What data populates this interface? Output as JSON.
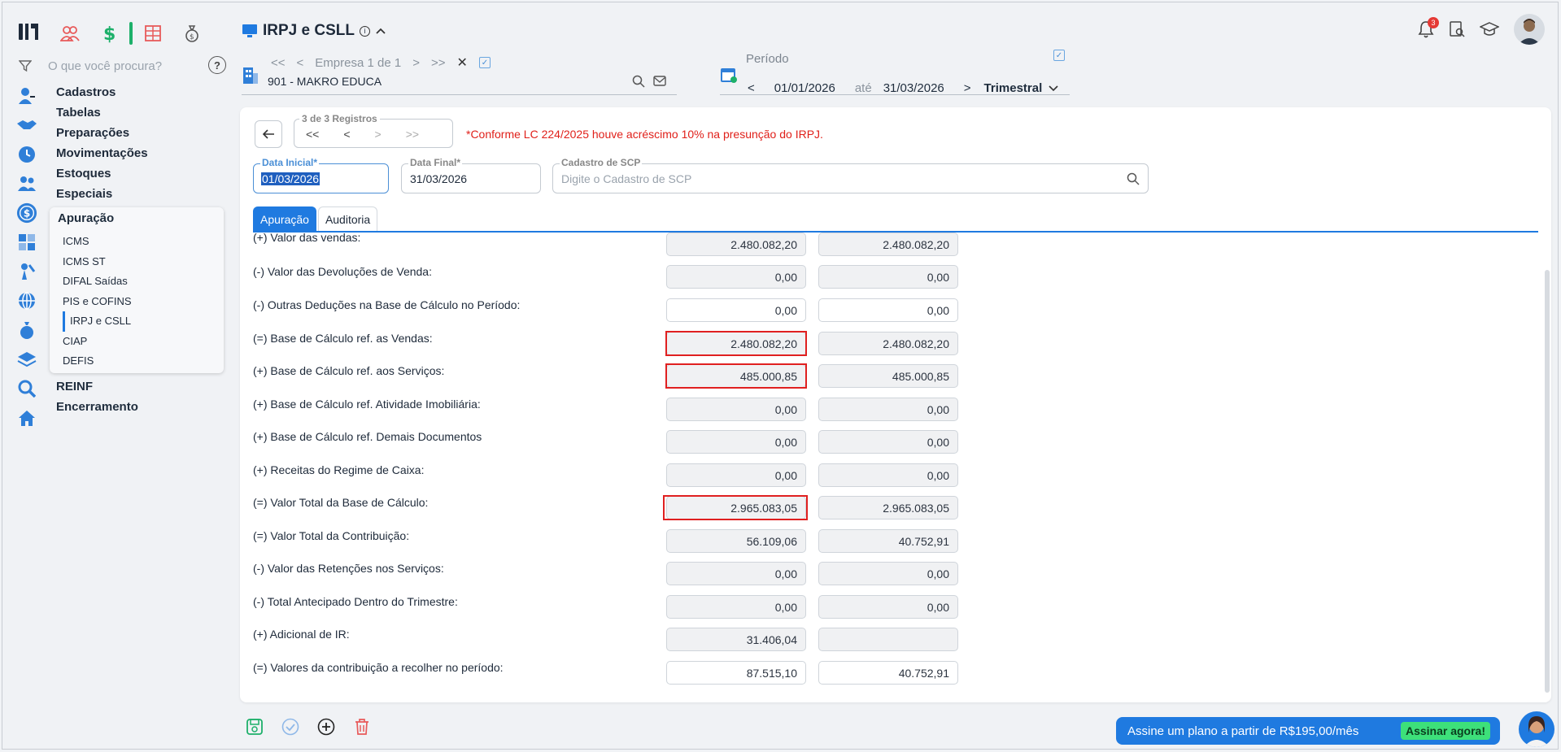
{
  "header": {
    "title": "IRPJ e CSLL",
    "search_placeholder": "O que você procura?",
    "notification_count": "3"
  },
  "menu": {
    "top_items": [
      "Cadastros",
      "Tabelas",
      "Preparações",
      "Movimentações",
      "Estoques",
      "Especiais"
    ],
    "section": "Apuração",
    "sub_items": [
      "ICMS",
      "ICMS ST",
      "DIFAL Saídas",
      "PIS e COFINS",
      "IRPJ e CSLL",
      "CIAP",
      "DEFIS"
    ],
    "active_sub": "IRPJ e CSLL",
    "bottom_items": [
      "REINF",
      "Encerramento"
    ]
  },
  "company": {
    "nav_label": "Empresa 1 de 1",
    "name": "901 - MAKRO EDUCA"
  },
  "periodo": {
    "label": "Período",
    "start": "01/01/2026",
    "sep": "até",
    "end": "31/03/2026",
    "type": "Trimestral"
  },
  "records": {
    "label": "3 de 3 Registros",
    "warning": "*Conforme LC 224/2025 houve acréscimo 10% na presunção do IRPJ."
  },
  "fields": {
    "data_inicial_label": "Data Inicial*",
    "data_inicial": "01/03/2026",
    "data_final_label": "Data Final*",
    "data_final": "31/03/2026",
    "scp_label": "Cadastro de SCP",
    "scp_placeholder": "Digite o Cadastro de SCP"
  },
  "tabs": [
    "Apuração",
    "Auditoria"
  ],
  "table": [
    {
      "label": "(+) Valor das vendas:",
      "v1": "2.480.082,20",
      "v2": "2.480.082,20",
      "white": false
    },
    {
      "label": "(-) Valor das Devoluções de Venda:",
      "v1": "0,00",
      "v2": "0,00",
      "white": false
    },
    {
      "label": "(-) Outras Deduções na Base de Cálculo no Período:",
      "v1": "0,00",
      "v2": "0,00",
      "white": true
    },
    {
      "label": "(=) Base de Cálculo ref. as Vendas:",
      "v1": "2.480.082,20",
      "v2": "2.480.082,20",
      "white": false,
      "hl": true
    },
    {
      "label": "(+) Base de Cálculo ref. aos Serviços:",
      "v1": "485.000,85",
      "v2": "485.000,85",
      "white": false,
      "hl": true
    },
    {
      "label": "(+) Base de Cálculo ref. Atividade Imobiliária:",
      "v1": "0,00",
      "v2": "0,00",
      "white": false
    },
    {
      "label": "(+) Base de Cálculo ref. Demais Documentos",
      "v1": "0,00",
      "v2": "0,00",
      "white": false
    },
    {
      "label": "(+) Receitas do Regime de Caixa:",
      "v1": "0,00",
      "v2": "0,00",
      "white": false
    },
    {
      "label": "(=) Valor Total da Base de Cálculo:",
      "v1": "2.965.083,05",
      "v2": "2.965.083,05",
      "white": false,
      "hl": true
    },
    {
      "label": "(=) Valor Total da Contribuição:",
      "v1": "56.109,06",
      "v2": "40.752,91",
      "white": false
    },
    {
      "label": "(-) Valor das Retenções nos Serviços:",
      "v1": "0,00",
      "v2": "0,00",
      "white": false
    },
    {
      "label": "(-) Total Antecipado Dentro do Trimestre:",
      "v1": "0,00",
      "v2": "0,00",
      "white": false
    },
    {
      "label": "(+) Adicional de IR:",
      "v1": "31.406,04",
      "v2": "",
      "white": false
    },
    {
      "label": "(=) Valores da contribuição a recolher no período:",
      "v1": "87.515,10",
      "v2": "40.752,91",
      "white": true
    }
  ],
  "plan": {
    "text": "Assine um plano a partir de R$195,00/mês",
    "cta": "Assinar agora!"
  },
  "colors": {
    "accent": "#1f7ae0",
    "warning": "#e0201a",
    "highlight": "#e02020",
    "green": "#1db06a"
  }
}
